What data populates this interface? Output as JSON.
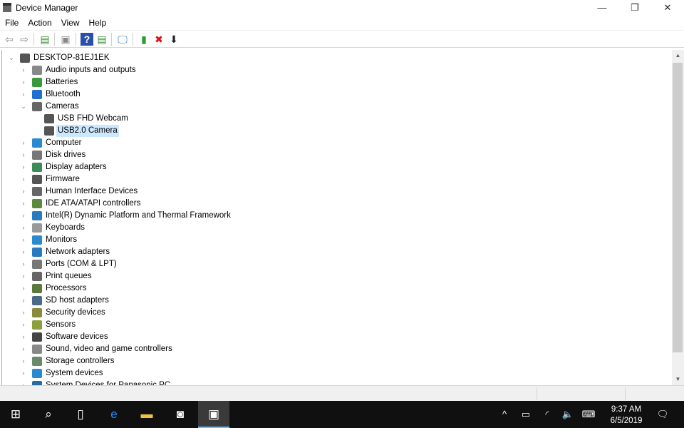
{
  "window": {
    "title": "Device Manager",
    "minimize": "—",
    "maximize": "❐",
    "close": "✕"
  },
  "menu": [
    "File",
    "Action",
    "View",
    "Help"
  ],
  "toolbar": [
    {
      "name": "back-icon",
      "glyph": "⇦",
      "color": "#888"
    },
    {
      "name": "forward-icon",
      "glyph": "⇨",
      "color": "#888"
    },
    {
      "name": "show-hide-console-tree-icon",
      "glyph": "▤",
      "color": "#3a8c3a"
    },
    {
      "name": "properties-icon",
      "glyph": "▣",
      "color": "#888"
    },
    {
      "name": "help-icon",
      "glyph": "?",
      "color": "#fff"
    },
    {
      "name": "show-action-pane-icon",
      "glyph": "▤",
      "color": "#3a8c3a"
    },
    {
      "name": "scan-hardware-icon",
      "glyph": "🖵",
      "color": "#2a7ac0"
    },
    {
      "name": "update-driver-icon",
      "glyph": "▮",
      "color": "#2a9a2a"
    },
    {
      "name": "uninstall-icon",
      "glyph": "✖",
      "color": "#e01010"
    },
    {
      "name": "disable-icon",
      "glyph": "⬇",
      "color": "#222"
    }
  ],
  "tree": {
    "root": "DESKTOP-81EJ1EK",
    "items": [
      {
        "label": "Audio inputs and outputs",
        "color": "#888"
      },
      {
        "label": "Batteries",
        "color": "#3a9a3a"
      },
      {
        "label": "Bluetooth",
        "color": "#1e6fd0"
      },
      {
        "label": "Cameras",
        "color": "#666",
        "expanded": true,
        "children": [
          {
            "label": "USB FHD Webcam",
            "color": "#555"
          },
          {
            "label": "USB2.0 Camera",
            "color": "#555",
            "selected": true
          }
        ]
      },
      {
        "label": "Computer",
        "color": "#2a8ad0"
      },
      {
        "label": "Disk drives",
        "color": "#777"
      },
      {
        "label": "Display adapters",
        "color": "#3a8a5a"
      },
      {
        "label": "Firmware",
        "color": "#555"
      },
      {
        "label": "Human Interface Devices",
        "color": "#666"
      },
      {
        "label": "IDE ATA/ATAPI controllers",
        "color": "#5a8a3a"
      },
      {
        "label": "Intel(R) Dynamic Platform and Thermal Framework",
        "color": "#2a7ac0"
      },
      {
        "label": "Keyboards",
        "color": "#999"
      },
      {
        "label": "Monitors",
        "color": "#2a8ad0"
      },
      {
        "label": "Network adapters",
        "color": "#2a7ac0"
      },
      {
        "label": "Ports (COM & LPT)",
        "color": "#777"
      },
      {
        "label": "Print queues",
        "color": "#666"
      },
      {
        "label": "Processors",
        "color": "#5a7a3a"
      },
      {
        "label": "SD host adapters",
        "color": "#4a6a8a"
      },
      {
        "label": "Security devices",
        "color": "#8a8a3a"
      },
      {
        "label": "Sensors",
        "color": "#8aa03a"
      },
      {
        "label": "Software devices",
        "color": "#444"
      },
      {
        "label": "Sound, video and game controllers",
        "color": "#888"
      },
      {
        "label": "Storage controllers",
        "color": "#6a8a6a"
      },
      {
        "label": "System devices",
        "color": "#2a8ad0"
      },
      {
        "label": "System Devices for Panasonic PC",
        "color": "#2a6aa0"
      }
    ]
  },
  "taskbar": {
    "apps": [
      {
        "name": "start-button",
        "glyph": "⊞"
      },
      {
        "name": "search-button",
        "glyph": "⌕"
      },
      {
        "name": "task-view-button",
        "glyph": "▯"
      },
      {
        "name": "edge-button",
        "glyph": "e"
      },
      {
        "name": "file-explorer-button",
        "glyph": "▬"
      },
      {
        "name": "camera-button",
        "glyph": "◙"
      },
      {
        "name": "device-manager-button",
        "glyph": "▣",
        "active": true
      }
    ],
    "tray": [
      {
        "name": "show-hidden-icons",
        "glyph": "^"
      },
      {
        "name": "battery-icon",
        "glyph": "▭"
      },
      {
        "name": "wifi-icon",
        "glyph": "◜"
      },
      {
        "name": "volume-icon",
        "glyph": "🔈"
      },
      {
        "name": "touch-keyboard-icon",
        "glyph": "⌨"
      }
    ],
    "time": "9:37 AM",
    "date": "6/5/2019",
    "notifications": "🗨"
  }
}
